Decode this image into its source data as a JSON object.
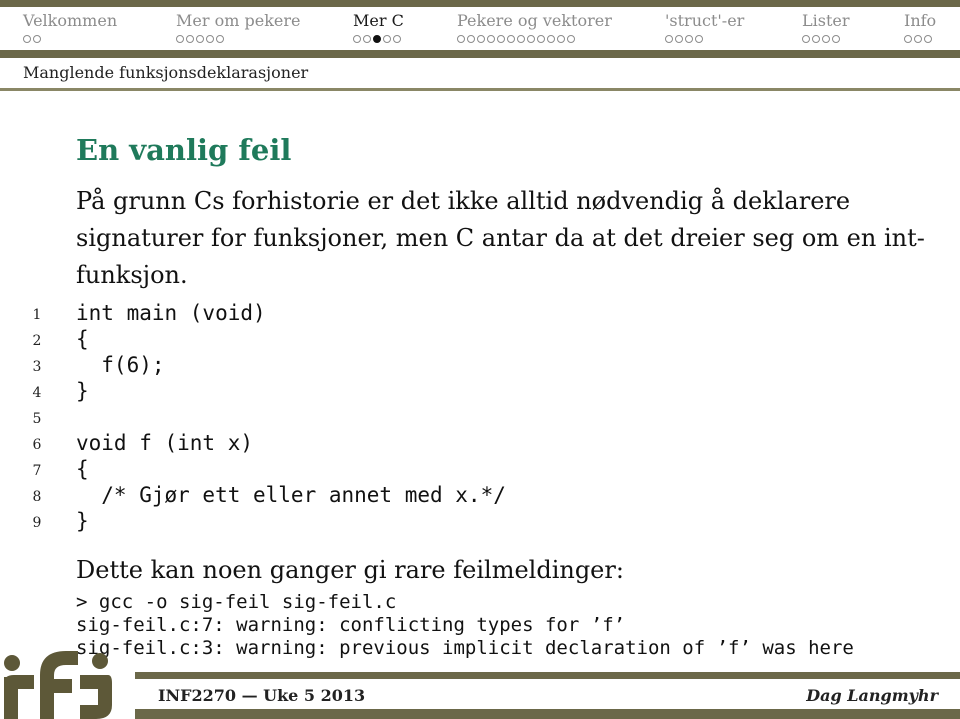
{
  "nav": {
    "sections": [
      {
        "label": "Velkommen",
        "dots": 2,
        "current": -1
      },
      {
        "label": "Mer om pekere",
        "dots": 5,
        "current": -1
      },
      {
        "label": "Mer C",
        "dots": 5,
        "current": 2,
        "active": true
      },
      {
        "label": "Pekere og vektorer",
        "dots": 12,
        "current": -1
      },
      {
        "label": "'struct'-er",
        "dots": 4,
        "current": -1
      },
      {
        "label": "Lister",
        "dots": 4,
        "current": -1
      },
      {
        "label": "Info",
        "dots": 3,
        "current": -1
      }
    ]
  },
  "subsection": "Manglende funksjonsdeklarasjoner",
  "frame": {
    "title": "En vanlig feil",
    "intro": "På grunn Cs forhistorie er det ikke alltid nødvendig å deklarere signaturer for funksjoner, men C antar da at det dreier seg om en int-funksjon.",
    "code": [
      {
        "n": "1",
        "text": "int main (void)"
      },
      {
        "n": "2",
        "text": "{"
      },
      {
        "n": "3",
        "text": "  f(6);"
      },
      {
        "n": "4",
        "text": "}"
      },
      {
        "n": "5",
        "text": ""
      },
      {
        "n": "6",
        "text": "void f (int x)"
      },
      {
        "n": "7",
        "text": "{"
      },
      {
        "n": "8",
        "text": "  /* Gjør ett eller annet med x.*/"
      },
      {
        "n": "9",
        "text": "}"
      }
    ],
    "after": "Dette kan noen ganger gi rare feilmeldinger:",
    "terminal": [
      "> gcc -o sig-feil sig-feil.c",
      "sig-feil.c:7: warning: conflicting types for ’f’",
      "sig-feil.c:3: warning: previous implicit declaration of ’f’ was here"
    ]
  },
  "footer": {
    "left": "INF2270 — Uke 5 2013",
    "right": "Dag Langmyhr",
    "logo": "ifi-logo"
  },
  "colors": {
    "bar": "#6b6849",
    "title": "#1f7a5b"
  }
}
